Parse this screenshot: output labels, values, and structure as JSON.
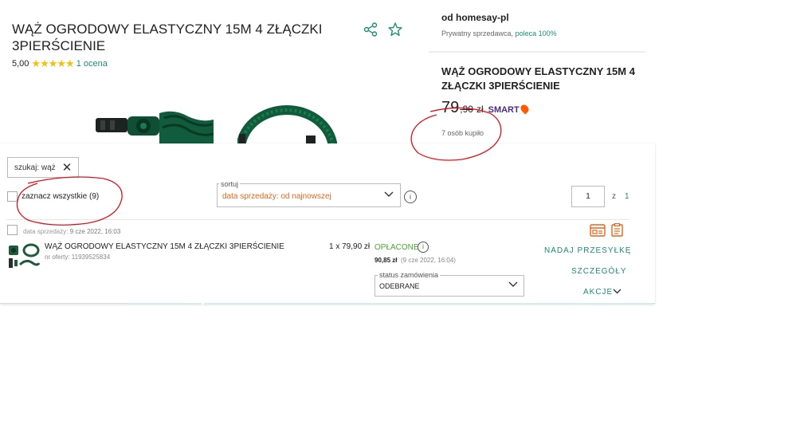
{
  "product": {
    "title": "WĄŻ OGRODOWY ELASTYCZNY 15M 4 ZŁĄCZKI 3PIERŚCIENIE",
    "rating_value": "5,00",
    "stars": "★★★★★",
    "rating_count": "1 ocena"
  },
  "seller": {
    "name": "od homesay-pl",
    "type": "Prywatny sprzedawca,",
    "recommend": "poleca 100%"
  },
  "price_box": {
    "title": "WĄŻ OGRODOWY ELASTYCZNY 15M 4 ZŁĄCZKI 3PIERŚCIENIE",
    "price_main": "79",
    "price_rest": ",90",
    "currency": "zł",
    "smart": "SMART",
    "buyers": "7 osób kupiło"
  },
  "orders": {
    "search_chip": "szukaj: wąż",
    "select_all": "zaznacz wszystkie (9)",
    "sort_label": "sortuj",
    "sort_value": "data sprzedaży: od najnowszej",
    "page_current": "1",
    "page_of": "z",
    "page_total": "1",
    "row": {
      "sale_date_label": "data sprzedaży:",
      "sale_date": "9 cze 2022, 16:03",
      "item_title": "WĄŻ OGRODOWY ELASTYCZNY 15M 4 ZŁĄCZKI 3PIERŚCIENIE",
      "offer_no": "nr oferty: 11939525834",
      "qty_price": "1 x 79,90 zł",
      "paid_status": "OPŁACONE",
      "paid_amount": "90,85 zł",
      "paid_date": "(9 cze 2022, 16:04)",
      "status_label": "status zamówienia",
      "status_value": "ODEBRANE",
      "ship_link": "NADAJ PRZESYŁKĘ",
      "details_link": "SZCZEGÓŁY",
      "actions_link": "AKCJE"
    }
  },
  "colors": {
    "accent": "#1a8f76",
    "sort_text": "#e3661a",
    "paid": "#4aa62e",
    "annotation": "#e0101a"
  }
}
